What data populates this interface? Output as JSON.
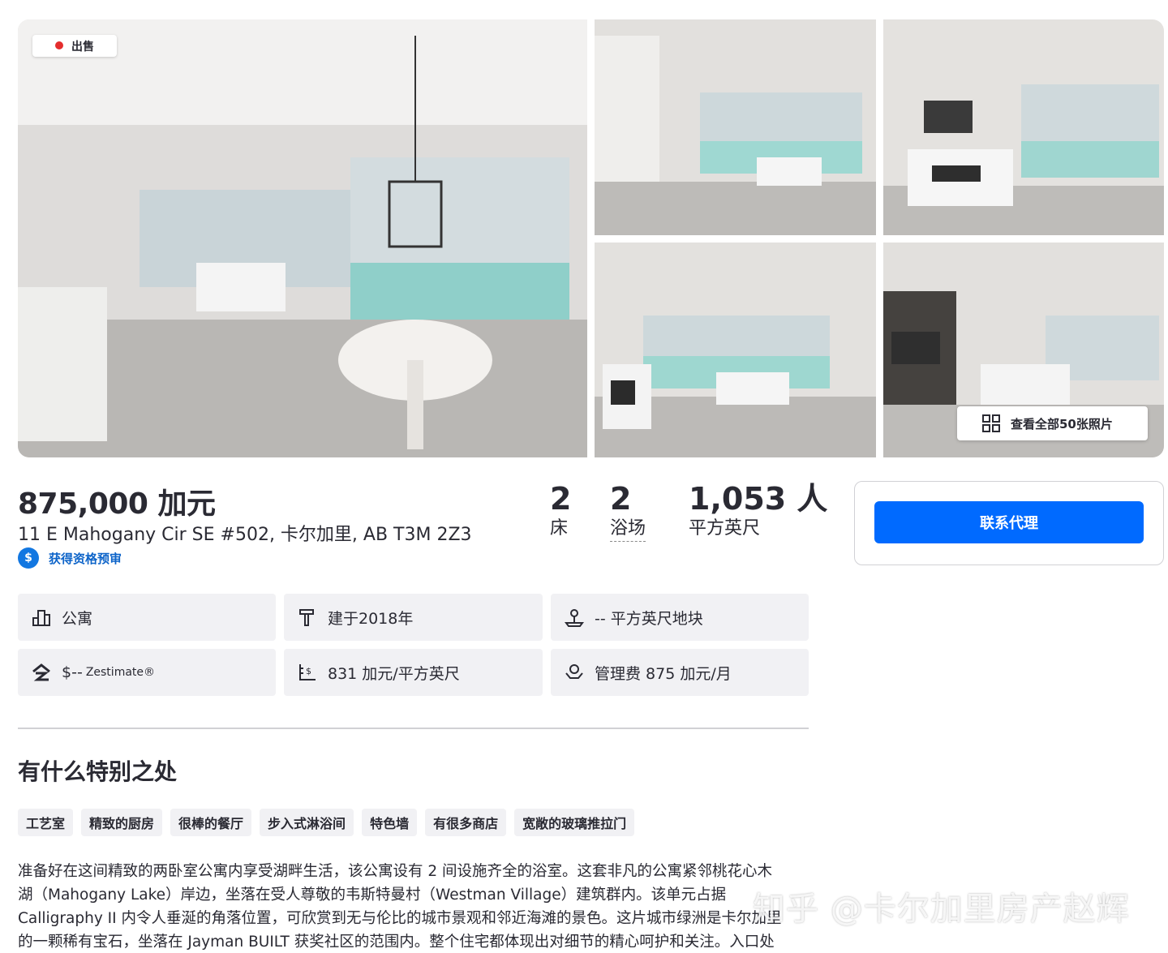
{
  "listing": {
    "status_badge": "出售",
    "all_photos_label": "查看全部50张照片",
    "price": "875,000 加元",
    "address": "11 E Mahogany Cir SE #502, 卡尔加里, AB T3M 2Z3",
    "prequal_label": "获得资格预审",
    "prequal_icon": "$"
  },
  "stats": {
    "beds": {
      "value": "2",
      "label": "床"
    },
    "baths": {
      "value": "2",
      "label": "浴场"
    },
    "area": {
      "value": "1,053 人",
      "label": "平方英尺"
    }
  },
  "contact": {
    "button_label": "联系代理"
  },
  "facts": {
    "type": "公寓",
    "built": "建于2018年",
    "lot": "-- 平方英尺地块",
    "zestimate_value": "$--",
    "zestimate_label": "Zestimate®",
    "price_per_sqft": "831 加元/平方英尺",
    "hoa": "管理费 875 加元/月"
  },
  "special": {
    "title": "有什么特别之处",
    "tags": [
      "工艺室",
      "精致的厨房",
      "很棒的餐厅",
      "步入式淋浴间",
      "特色墙",
      "有很多商店",
      "宽敞的玻璃推拉门"
    ],
    "description_lines": [
      "准备好在这间精致的两卧室公寓内享受湖畔生活，该公寓设有 2 间设施齐全的浴室。这套非凡的公寓紧邻桃花心木",
      "湖（Mahogany Lake）岸边，坐落在受人尊敬的韦斯特曼村（Westman Village）建筑群内。该单元占据",
      "Calligraphy II 内令人垂涎的角落位置，可欣赏到无与伦比的城市景观和邻近海滩的景色。这片城市绿洲是卡尔加里",
      "的一颗稀有宝石，坐落在 Jayman BUILT 获奖社区的范围内。整个住宅都体现出对细节的精心呵护和关注。入口处"
    ]
  },
  "watermark": "知乎 @卡尔加里房产赵辉",
  "colors": {
    "accent": "#006aff",
    "link": "#0d64c9",
    "sale_dot": "#e42d2d",
    "chip_bg": "#f1f1f4"
  }
}
